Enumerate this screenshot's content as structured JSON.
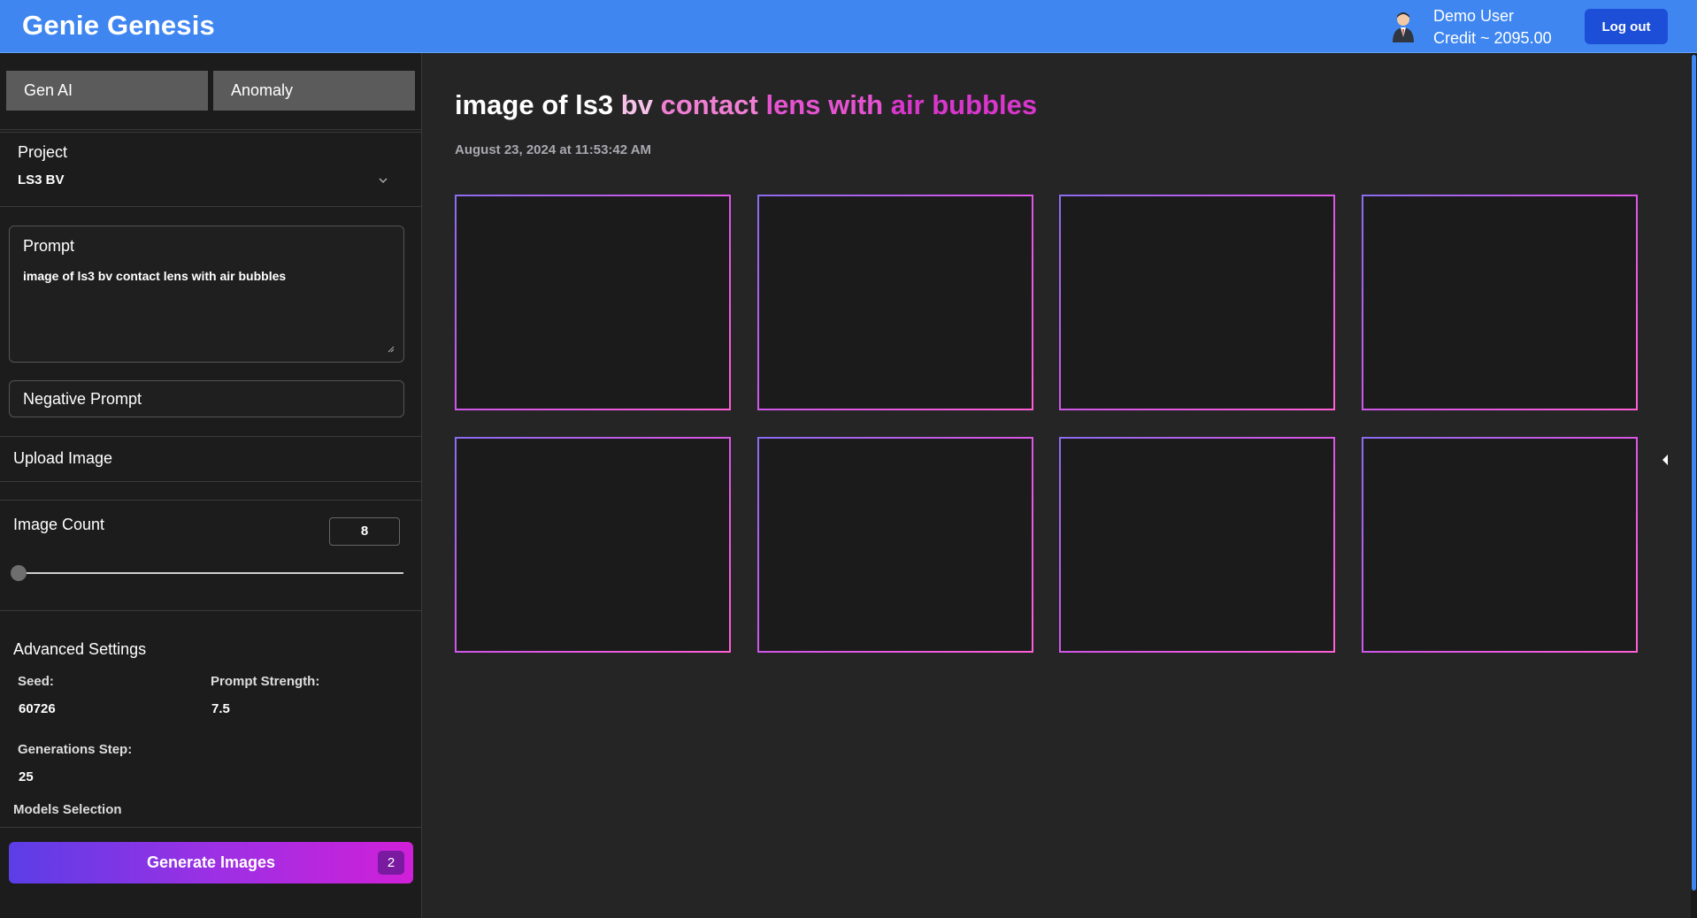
{
  "header": {
    "app_title": "Genie Genesis",
    "user_name": "Demo User",
    "credit": "Credit ~ 2095.00",
    "logout_label": "Log out"
  },
  "sidebar": {
    "tabs": [
      {
        "label": "Gen AI"
      },
      {
        "label": "Anomaly"
      }
    ],
    "project": {
      "label": "Project",
      "value": "LS3 BV"
    },
    "prompt": {
      "label": "Prompt",
      "value": "image of ls3 bv contact lens with air bubbles"
    },
    "negative_prompt": {
      "label": "Negative Prompt"
    },
    "upload_image": {
      "label": "Upload Image"
    },
    "image_count": {
      "label": "Image Count",
      "value": "8"
    },
    "advanced": {
      "label": "Advanced Settings",
      "seed_label": "Seed:",
      "seed_value": "60726",
      "strength_label": "Prompt Strength:",
      "strength_value": "7.5",
      "steps_label": "Generations Step:",
      "steps_value": "25",
      "models_label": "Models Selection"
    },
    "generate": {
      "label": "Generate Images",
      "badge": "2"
    }
  },
  "main": {
    "title_parts": [
      "image of ls3 ",
      "bv ",
      "contact ",
      "lens with ",
      "air bubbles"
    ],
    "timestamp": "August 23, 2024 at 11:53:42 AM"
  },
  "colors": {
    "header_bg": "#3f86f0",
    "logout_bg": "#1d4ed8",
    "generate_gradient_start": "#5b3ee6",
    "generate_gradient_end": "#d020d8"
  }
}
